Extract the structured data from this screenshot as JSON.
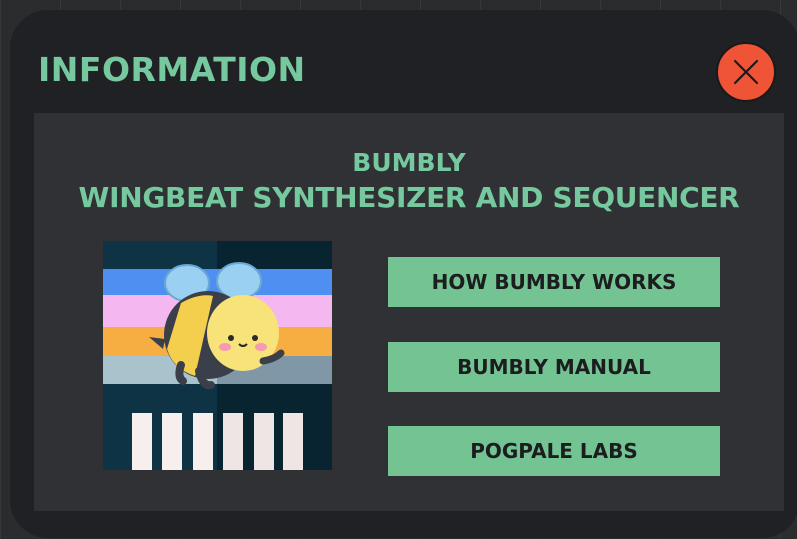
{
  "dialog": {
    "title": "INFORMATION",
    "close_icon": "close-x-icon",
    "close_color": "#ef5436"
  },
  "about": {
    "app_name": "BUMBLY",
    "subtitle": "WINGBEAT SYNTHESIZER AND SEQUENCER",
    "logo_icon": "bee-logo-icon"
  },
  "links": {
    "how_it_works": "HOW BUMBLY WORKS",
    "manual": "BUMBLY MANUAL",
    "lab": "POGPALE LABS"
  },
  "colors": {
    "accent": "#76c99e",
    "button_bg": "#73c492",
    "dialog_bg": "#202124",
    "panel_bg": "#303134"
  }
}
